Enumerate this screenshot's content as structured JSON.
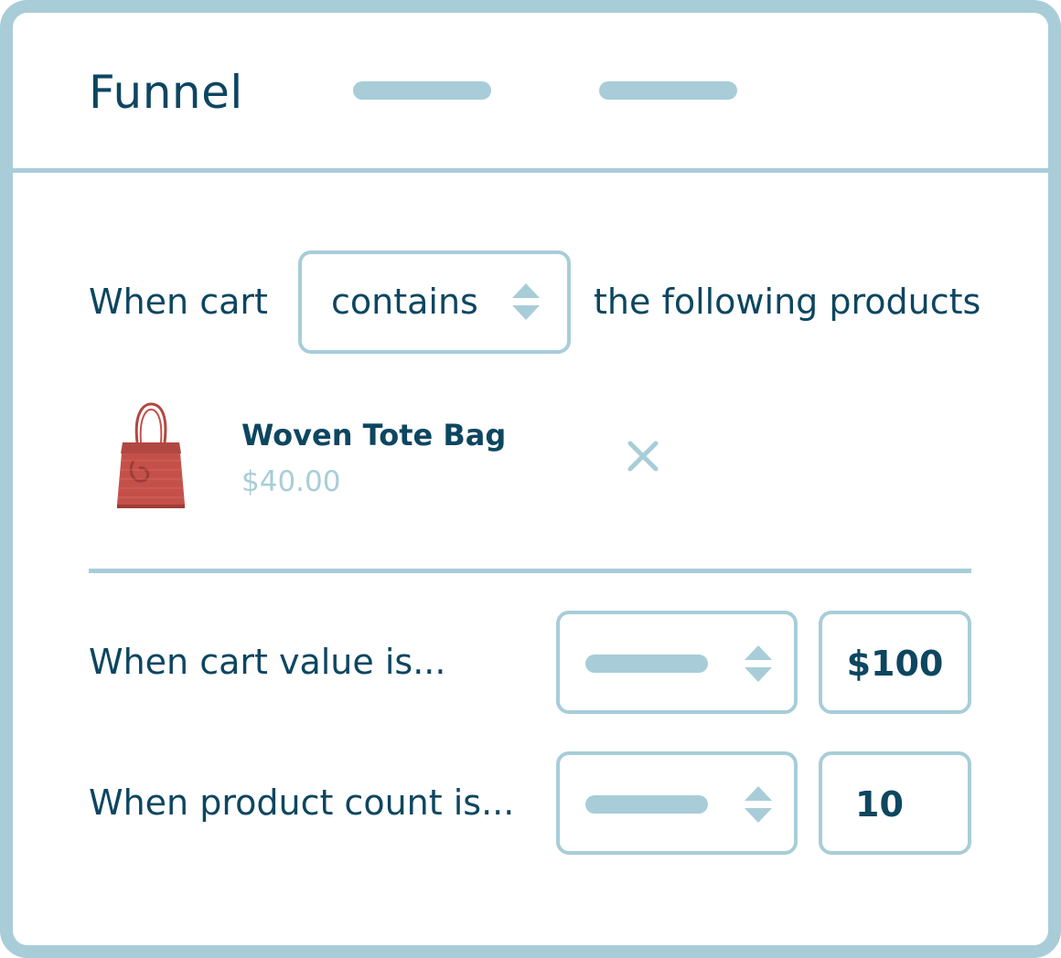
{
  "header": {
    "title": "Funnel"
  },
  "rule_products": {
    "prefix": "When cart",
    "operator": "contains",
    "suffix": "the following products",
    "products": [
      {
        "name": "Woven Tote Bag",
        "price": "$40.00",
        "thumbnail": "woven-tote-bag-image"
      }
    ]
  },
  "rule_value": {
    "label": "When cart value is...",
    "amount": "$100"
  },
  "rule_count": {
    "label": "When product count is...",
    "amount": "10"
  },
  "colors": {
    "accent_light": "#a8cdd8",
    "text_dark": "#0d4660",
    "product_red": "#c5504a"
  }
}
